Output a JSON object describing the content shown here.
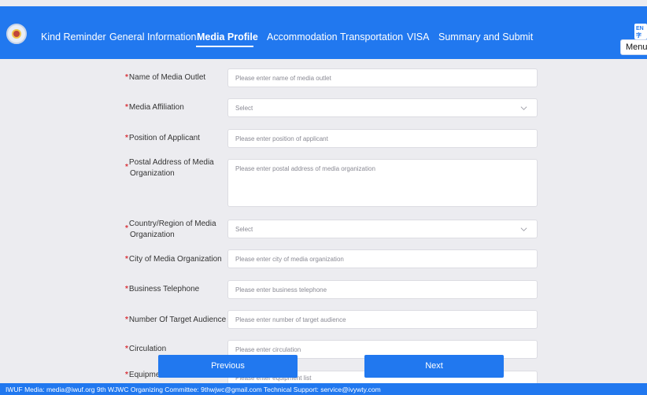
{
  "nav": {
    "items": [
      "Kind Reminder",
      "General Information",
      "Media Profile",
      "Accommodation",
      "Transportation",
      "VISA",
      "Summary and Submit"
    ],
    "active": "Media Profile",
    "menu_label": "Menu",
    "translate_icon_text": "EN字"
  },
  "form": {
    "fields": [
      {
        "label": "Name of Media Outlet",
        "placeholder": "Please enter name of media outlet",
        "required": true
      },
      {
        "label": "Media Affiliation",
        "placeholder": "Select",
        "required": true,
        "type": "select"
      },
      {
        "label": "Position of Applicant",
        "placeholder": "Please enter position of applicant",
        "required": true
      },
      {
        "label_line1": "Postal Address of Media",
        "label_line2": "Organization",
        "placeholder": "Please enter postal address of media organization",
        "required": true,
        "type": "textarea"
      },
      {
        "label_line1": "Country/Region of Media",
        "label_line2": "Organization",
        "placeholder": "Select",
        "required": true,
        "type": "select"
      },
      {
        "label": "City of Media Organization",
        "placeholder": "Please enter city of media organization",
        "required": true
      },
      {
        "label": "Business Telephone",
        "placeholder": "Please enter business telephone",
        "required": true
      },
      {
        "label": "Number Of Target Audience",
        "placeholder": "Please enter number of target audience",
        "required": true
      },
      {
        "label": "Circulation",
        "placeholder": "Please enter circulation",
        "required": true
      },
      {
        "label": "Equipment List",
        "placeholder": "Please enter equipment list",
        "required": true
      }
    ],
    "required_mark": "*"
  },
  "buttons": {
    "previous": "Previous",
    "next": "Next"
  },
  "footer": {
    "text": "IWUF Media: media@iwuf.org 9th WJWC Organizing Committee: 9thwjwc@gmail.com Technical Support: service@ivywty.com"
  },
  "colors": {
    "brand_blue": "#2178ef",
    "required_red": "#d9363e",
    "background": "#ececf0"
  }
}
